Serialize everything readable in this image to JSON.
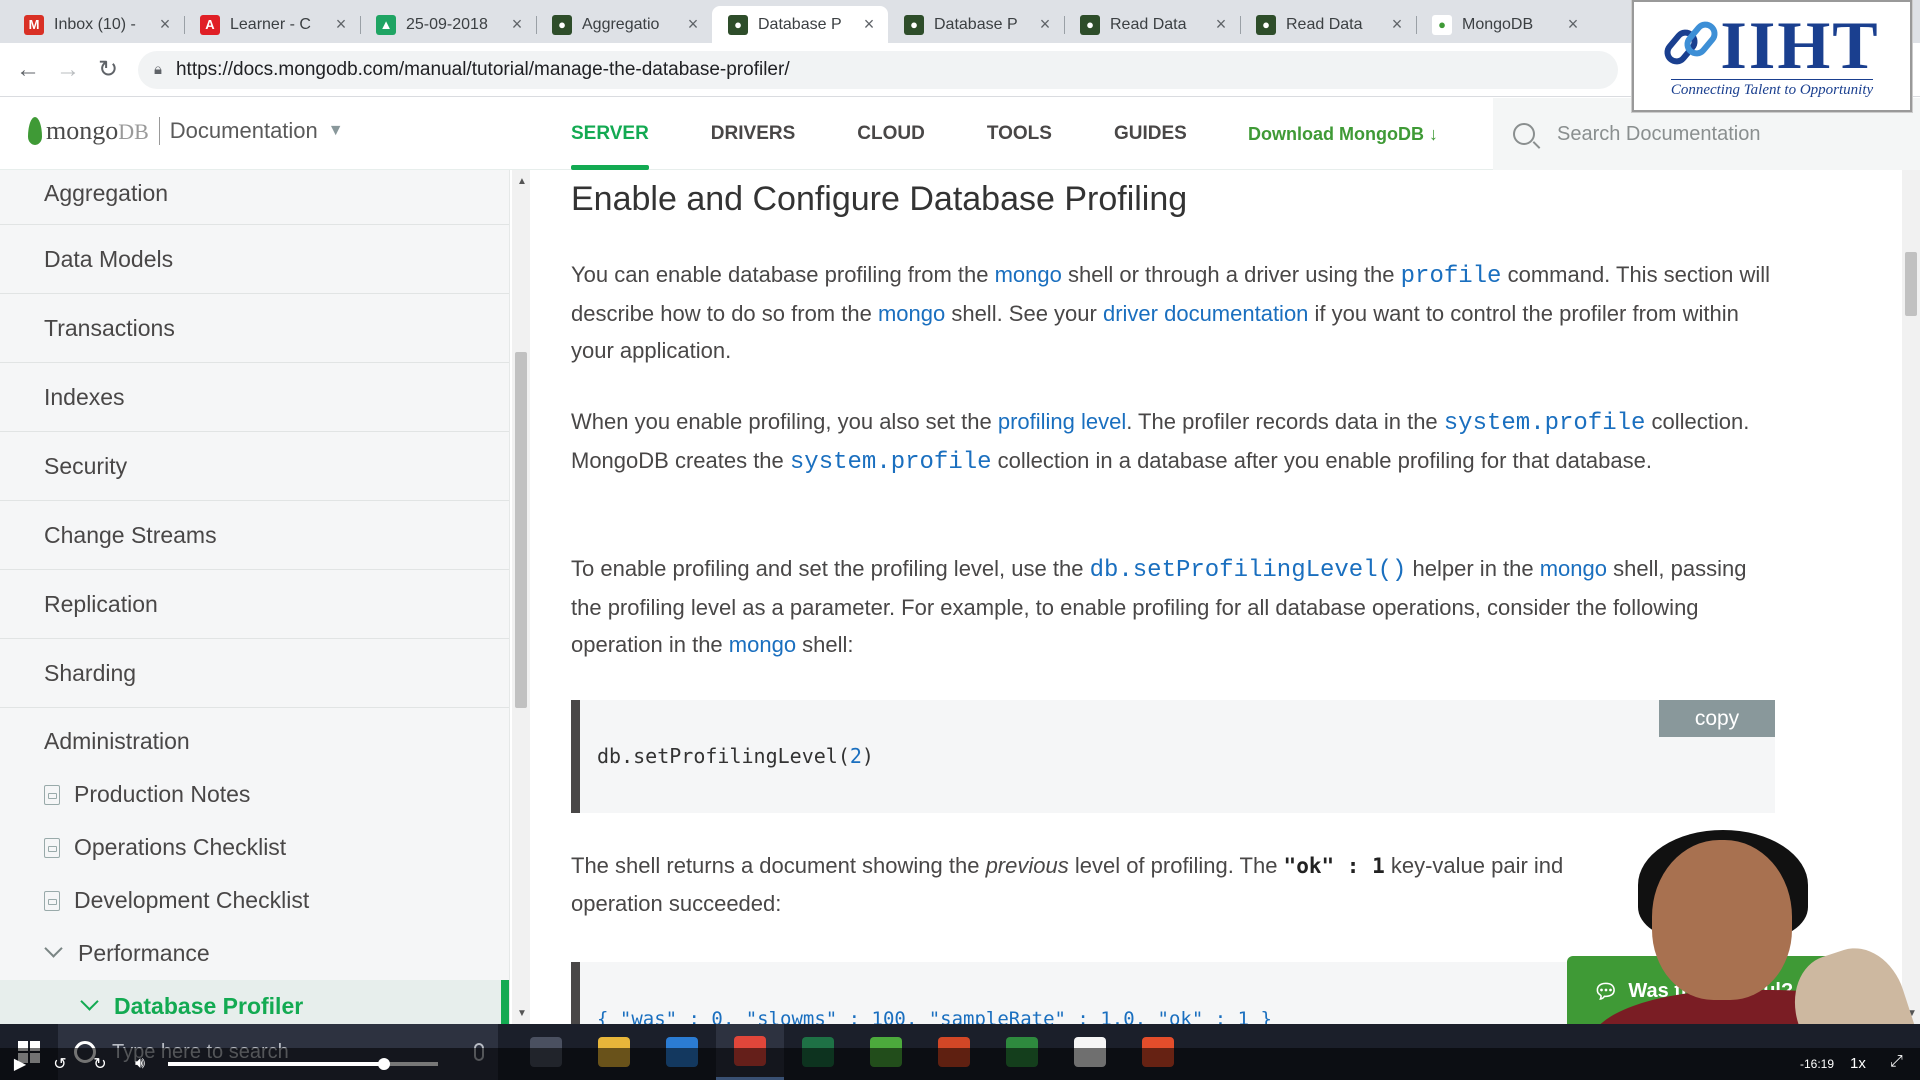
{
  "browser": {
    "tabs": [
      {
        "title": "Inbox (10) -",
        "icon": "gmail-icon",
        "color": "#d93025",
        "glyph": "M"
      },
      {
        "title": "Learner - C",
        "icon": "adobe-icon",
        "color": "#e01f26",
        "glyph": "A"
      },
      {
        "title": "25-09-2018",
        "icon": "drive-icon",
        "color": "#1fa463",
        "glyph": "▲"
      },
      {
        "title": "Aggregatio",
        "icon": "mongodb-icon",
        "color": "#2e4d2a",
        "glyph": "●"
      },
      {
        "title": "Database P",
        "icon": "mongodb-icon",
        "color": "#2e4d2a",
        "glyph": "●",
        "active": true
      },
      {
        "title": "Database P",
        "icon": "mongodb-icon",
        "color": "#2e4d2a",
        "glyph": "●"
      },
      {
        "title": "Read Data",
        "icon": "mongodb-icon",
        "color": "#2e4d2a",
        "glyph": "●"
      },
      {
        "title": "Read Data",
        "icon": "mongodb-icon",
        "color": "#2e4d2a",
        "glyph": "●"
      },
      {
        "title": "MongoDB",
        "icon": "mongodb-leaf-icon",
        "color": "#ffffff",
        "glyph": "●"
      }
    ],
    "url": "https://docs.mongodb.com/manual/tutorial/manage-the-database-profiler/"
  },
  "overlay_logo": {
    "word": "IIHT",
    "tagline": "Connecting Talent to Opportunity"
  },
  "header": {
    "brand": "mongo",
    "brand_suffix": "DB",
    "section": "Documentation",
    "nav": [
      {
        "label": "SERVER",
        "active": true
      },
      {
        "label": "DRIVERS"
      },
      {
        "label": "CLOUD"
      },
      {
        "label": "TOOLS"
      },
      {
        "label": "GUIDES"
      }
    ],
    "download": "Download MongoDB ↓",
    "search_placeholder": "Search Documentation"
  },
  "sidebar": {
    "items": [
      "Aggregation",
      "Data Models",
      "Transactions",
      "Indexes",
      "Security",
      "Change Streams",
      "Replication",
      "Sharding"
    ],
    "group": "Administration",
    "subitems": [
      "Production Notes",
      "Operations Checklist",
      "Development Checklist"
    ],
    "expanded": "Performance",
    "current": "Database Profiler"
  },
  "content": {
    "title": "Enable and Configure Database Profiling",
    "p1": {
      "a": "You can enable database profiling from the ",
      "mongo1": "mongo",
      "b": " shell or through a driver using the ",
      "profile": "profile",
      "c": " command. This section will describe how to do so from the ",
      "mongo2": "mongo",
      "d": " shell. See your ",
      "driverdoc": "driver documentation",
      "e": " if you want to control the profiler from within your application."
    },
    "p2": {
      "a": "When you enable profiling, you also set the ",
      "level": "profiling level",
      "b": ". The profiler records data in the ",
      "sp1": "system.profile",
      "c": " collection. MongoDB creates the ",
      "sp2": "system.profile",
      "d": " collection in a database after you enable profiling for that database."
    },
    "p3": {
      "a": "To enable profiling and set the profiling level, use the ",
      "fn": "db.setProfilingLevel()",
      "b": " helper in the ",
      "mongo": "mongo",
      "c": " shell, passing the profiling level as a parameter. For example, to enable profiling for all database operations, consider the following operation in the ",
      "mongo2": "mongo",
      "d": " shell:"
    },
    "code1": {
      "fn": "db.setProfilingLevel(",
      "arg": "2",
      "end": ")"
    },
    "copy": "copy",
    "p4": {
      "a": "The shell returns a document showing the ",
      "em": "previous",
      "b": " level of profiling. The ",
      "k": "\"ok\"",
      "colon": " : ",
      "v": "1",
      "c": " key-value pair ind",
      "d": "operation succeeded:"
    },
    "code2": "{ \"was\" : 0, \"slowms\" : 100, \"sampleRate\" : 1.0, \"ok\" : 1 }",
    "feedback": "Was this helpful?"
  },
  "taskbar": {
    "search_placeholder": "Type here to search",
    "apps": [
      {
        "name": "task-view-icon",
        "color": "#4a5060"
      },
      {
        "name": "file-explorer-icon",
        "color": "#e8b63a"
      },
      {
        "name": "internet-explorer-icon",
        "color": "#2b7cd3"
      },
      {
        "name": "chrome-icon",
        "color": "#e0463a",
        "active": true
      },
      {
        "name": "excel-icon",
        "color": "#1e7145"
      },
      {
        "name": "camtasia-icon",
        "color": "#4caa3c"
      },
      {
        "name": "powerpoint-icon",
        "color": "#d24726"
      },
      {
        "name": "robo3t-icon",
        "color": "#2e8a3e"
      },
      {
        "name": "mongodb-compass-icon",
        "color": "#f5f5f5"
      },
      {
        "name": "app-icon",
        "color": "#e34d2b"
      }
    ]
  },
  "video": {
    "progress": 0.8,
    "time": "-16:19",
    "speed": "1x"
  }
}
